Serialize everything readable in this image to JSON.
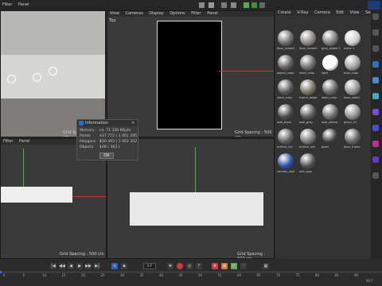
{
  "top_menu": [
    "Filter",
    "Panel"
  ],
  "viewport_menu": [
    "View",
    "Cameras",
    "Display",
    "Options",
    "Filter",
    "Panel"
  ],
  "viewports": {
    "top_left_grid": "Grid Spacing : 500 cm",
    "top_right_label": "Top",
    "top_right_grid": "Grid Spacing : 500 cm",
    "bottom_left_grid": "Grid Spacing : 500 cm",
    "bottom_right_grid": "Grid Spacing : 500 cm",
    "bottom_menu": [
      "Filter",
      "Panel"
    ]
  },
  "material_panel": {
    "tabs": [
      "Create",
      "V-Ray",
      "Camera",
      "Edit",
      "View",
      "Select"
    ],
    "materials": [
      {
        "label": "floor_metal1",
        "color": "#6d6d6d"
      },
      {
        "label": "floor_metal0",
        "color": "#8a8580"
      },
      {
        "label": "grey_metal 1",
        "color": "#7a7a7a"
      },
      {
        "label": "white 1",
        "color": "#cfcfcf"
      },
      {
        "label": "object_color",
        "color": "#5c5c5c"
      },
      {
        "label": "steel_color",
        "color": "#6a6a6a"
      },
      {
        "label": "light",
        "color": "#ffffff"
      },
      {
        "label": "bulb_color",
        "color": "#a0a0a0"
      },
      {
        "label": "steel_color",
        "color": "#575757"
      },
      {
        "label": "frame_beige",
        "color": "#777268"
      },
      {
        "label": "steel_color",
        "color": "#656565"
      },
      {
        "label": "door_sided",
        "color": "#909090"
      },
      {
        "label": "wall_black",
        "color": "#4a4a4a"
      },
      {
        "label": "wall_grey",
        "color": "#5a5a5a"
      },
      {
        "label": "wall_yellow",
        "color": "#6a6a6a"
      },
      {
        "label": "grey1_01",
        "color": "#8d8d8d"
      },
      {
        "label": "outline_Ani",
        "color": "#5e5e5e"
      },
      {
        "label": "outline_vet",
        "color": "#777777"
      },
      {
        "label": "glass",
        "color": "#3d3d3d"
      },
      {
        "label": "door_frame",
        "color": "#626262"
      },
      {
        "label": "caution_wall",
        "color": "#2a4fa8"
      },
      {
        "label": "exit_sign",
        "color": "#4f4f4f"
      }
    ]
  },
  "info_dialog": {
    "title": "Information",
    "rows": [
      {
        "key": "Memory",
        "value": "ca. 71.336 KByte"
      },
      {
        "key": "Points",
        "value": "437 772 ( 1 001 295 )"
      },
      {
        "key": "Polygons",
        "value": "430 493 ( 1 052 302 )"
      },
      {
        "key": "Objects",
        "value": "108 ( 363 )"
      }
    ],
    "ok_label": "OK"
  },
  "timeline": {
    "frame_field": "0 F",
    "ticks": [
      "0",
      "5",
      "10",
      "15",
      "20",
      "25",
      "30",
      "35",
      "40",
      "45",
      "50",
      "55",
      "60",
      "65",
      "70",
      "75",
      "80",
      "85",
      "90"
    ],
    "end_label": "90 F"
  },
  "accent_colors": {
    "ok_green": "#2fb84a",
    "record_red": "#d03a3a",
    "timeline_blue": "#4a6fd4",
    "material_select": "#2a4fa8"
  }
}
